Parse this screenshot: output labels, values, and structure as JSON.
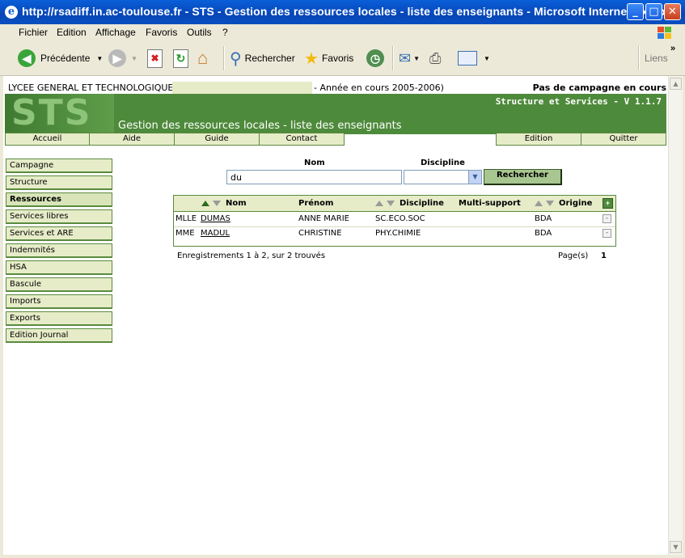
{
  "window": {
    "title": "http://rsadiff.in.ac-toulouse.fr - STS - Gestion des ressources locales - liste des enseignants - Microsoft Internet Explo...",
    "min_label": "_",
    "max_label": "□",
    "close_label": "✕"
  },
  "menubar": {
    "items": [
      "Fichier",
      "Edition",
      "Affichage",
      "Favoris",
      "Outils",
      "?"
    ]
  },
  "toolbar": {
    "back_label": "Précédente",
    "search_label": "Rechercher",
    "favorites_label": "Favoris",
    "links_label": "Liens"
  },
  "page": {
    "school": "LYCEE GENERAL ET TECHNOLOGIQUE",
    "year": "- Année en cours 2005-2006)",
    "campaign": "Pas de campagne en cours",
    "logo": "STS",
    "version": "Structure et Services - V 1.1.7",
    "title": "Gestion des ressources locales - liste des enseignants",
    "tabs": [
      "Accueil",
      "Aide",
      "Guide",
      "Contact",
      "Edition",
      "Quitter"
    ],
    "sidebar": [
      "Campagne",
      "Structure",
      "Ressources",
      "Services libres",
      "Services et ARE",
      "Indemnités",
      "HSA",
      "Bascule",
      "Imports",
      "Exports",
      "Edition Journal"
    ],
    "search": {
      "nom_label": "Nom",
      "nom_value": "du",
      "discipline_label": "Discipline",
      "button": "Rechercher"
    },
    "grid": {
      "headers": {
        "nom": "Nom",
        "prenom": "Prénom",
        "discipline": "Discipline",
        "multi": "Multi-support",
        "origine": "Origine"
      },
      "rows": [
        {
          "civ": "MLLE",
          "nom": "DUMAS",
          "prenom": "ANNE MARIE",
          "discipline": "SC.ECO.SOC",
          "origine": "BDA"
        },
        {
          "civ": "MME",
          "nom": "MADUL",
          "prenom": "CHRISTINE",
          "discipline": "PHY.CHIMIE",
          "origine": "BDA"
        }
      ],
      "records": "Enregistrements 1 à 2, sur 2 trouvés",
      "pages_label": "Page(s)",
      "page_current": "1"
    }
  }
}
